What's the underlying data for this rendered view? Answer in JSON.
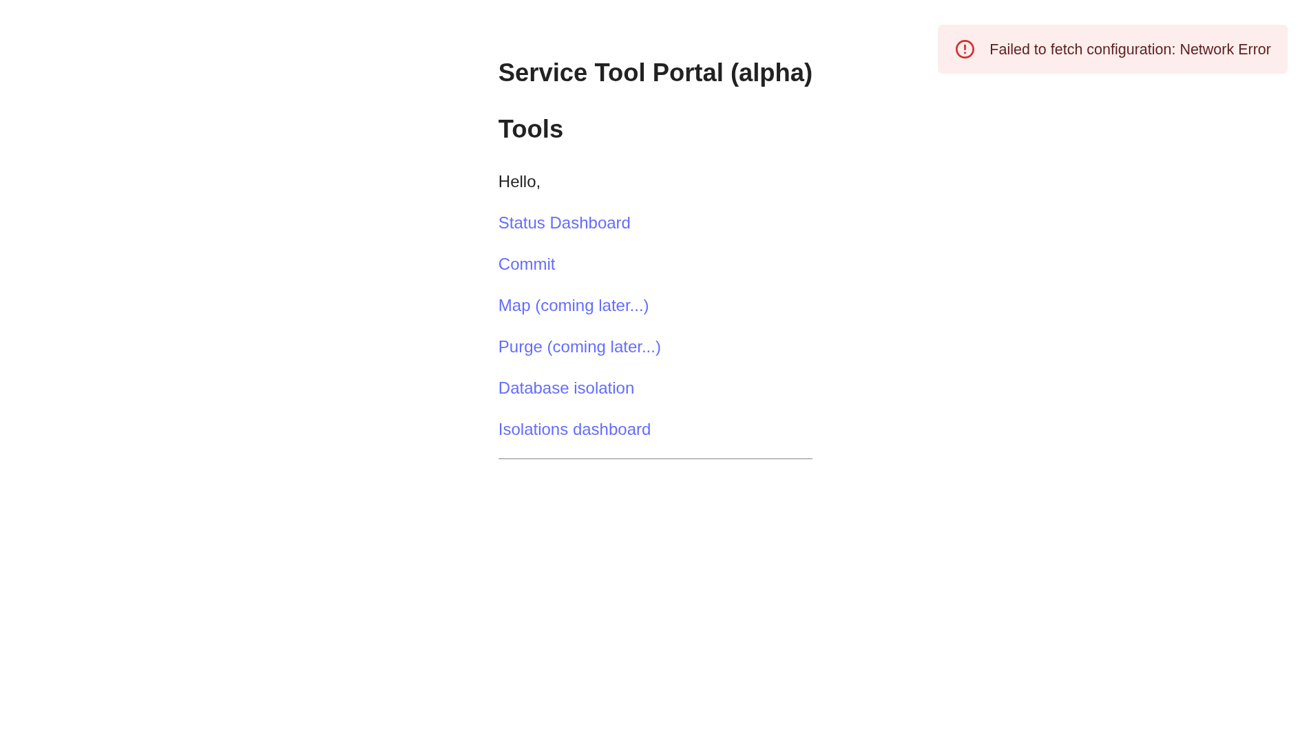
{
  "alert": {
    "message": "Failed to fetch configuration: Network Error"
  },
  "page": {
    "title": "Service Tool Portal (alpha)",
    "section_title": "Tools",
    "greeting": "Hello,",
    "links": [
      {
        "label": "Status Dashboard"
      },
      {
        "label": "Commit"
      },
      {
        "label": "Map (coming later...)"
      },
      {
        "label": "Purge (coming later...)"
      },
      {
        "label": "Database isolation"
      },
      {
        "label": "Isolations dashboard"
      }
    ]
  }
}
